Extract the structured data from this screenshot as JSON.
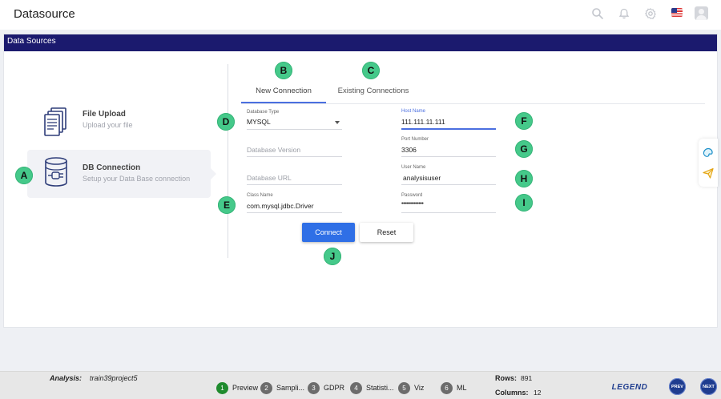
{
  "app": {
    "title": "Datasource"
  },
  "topbar": {
    "icons": [
      "search-icon",
      "bell-icon",
      "gear-icon",
      "us-flag-icon",
      "user-avatar-icon"
    ]
  },
  "card": {
    "header": "Data Sources"
  },
  "sources": [
    {
      "title": "File Upload",
      "subtitle": "Upload your file",
      "icon": "file-stack-icon",
      "active": false
    },
    {
      "title": "DB Connection",
      "subtitle": "Setup your Data Base connection",
      "icon": "database-plug-icon",
      "active": true
    }
  ],
  "tabs": [
    {
      "label": "New Connection",
      "active": true
    },
    {
      "label": "Existing Connections",
      "active": false
    }
  ],
  "form": {
    "database_type": {
      "label": "Database Type",
      "value": "MYSQL"
    },
    "database_version": {
      "placeholder": "Database Version"
    },
    "database_url": {
      "placeholder": "Database URL"
    },
    "class_name": {
      "label": "Class Name",
      "value": "com.mysql.jdbc.Driver"
    },
    "host_name": {
      "label": "Host Name",
      "value": "111.111.11.111"
    },
    "port_number": {
      "label": "Port Number",
      "value": "3306"
    },
    "user_name": {
      "label": "User Name",
      "value": "analysisuser"
    },
    "password": {
      "label": "Password",
      "value": "••••••••••••••"
    }
  },
  "buttons": {
    "connect": "Connect",
    "reset": "Reset"
  },
  "markers": [
    "A",
    "B",
    "C",
    "D",
    "E",
    "F",
    "G",
    "H",
    "I",
    "J"
  ],
  "bottombar": {
    "analysis_label": "Analysis:",
    "analysis_value": "train39project5",
    "steps": [
      {
        "num": "1",
        "label": "Preview",
        "active": true
      },
      {
        "num": "2",
        "label": "Sampli...",
        "active": false
      },
      {
        "num": "3",
        "label": "GDPR",
        "active": false
      },
      {
        "num": "4",
        "label": "Statisti...",
        "active": false
      },
      {
        "num": "5",
        "label": "Viz",
        "active": false
      },
      {
        "num": "6",
        "label": "ML",
        "active": false
      }
    ],
    "rows_label": "Rows:",
    "rows_value": "891",
    "columns_label": "Columns:",
    "columns_value": "12",
    "legend": "LEGEND",
    "prev": "PREV",
    "next": "NEXT"
  },
  "colors": {
    "header": "#1b1a6e",
    "accent": "#2f6fe6",
    "marker": "#45c98a",
    "step_active": "#1f8b2e"
  }
}
